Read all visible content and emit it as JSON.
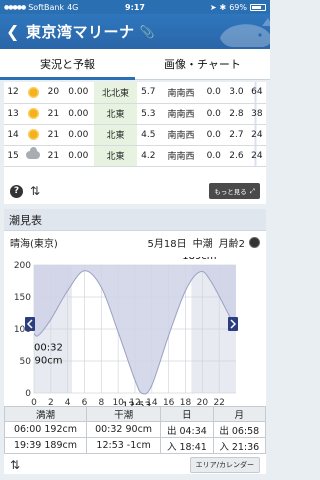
{
  "status": {
    "carrier": "SoftBank",
    "network": "4G",
    "time": "9:17",
    "battery": "69%"
  },
  "header": {
    "title": "東京湾マリーナ"
  },
  "tabs": [
    {
      "label": "実況と予報"
    },
    {
      "label": "画像・チャート"
    }
  ],
  "forecast": {
    "rows": [
      {
        "hour": "12",
        "weather": "sun",
        "temp": "20",
        "precip": "0.00",
        "wind_dir": "北北東",
        "wind_speed": "5.7",
        "wave_dir": "南南西",
        "wave_h": "0.0",
        "wave_p": "3.0",
        "last": "64"
      },
      {
        "hour": "13",
        "weather": "sun",
        "temp": "21",
        "precip": "0.00",
        "wind_dir": "北東",
        "wind_speed": "5.3",
        "wave_dir": "南南西",
        "wave_h": "0.0",
        "wave_p": "2.8",
        "last": "38"
      },
      {
        "hour": "14",
        "weather": "sun",
        "temp": "21",
        "precip": "0.00",
        "wind_dir": "北東",
        "wind_speed": "4.5",
        "wave_dir": "南南西",
        "wave_h": "0.0",
        "wave_p": "2.7",
        "last": "24"
      },
      {
        "hour": "15",
        "weather": "cloud",
        "temp": "21",
        "precip": "0.00",
        "wind_dir": "北東",
        "wind_speed": "4.2",
        "wave_dir": "南南西",
        "wave_h": "0.0",
        "wave_p": "2.6",
        "last": "24"
      }
    ],
    "more_label": "もっと見る"
  },
  "tide": {
    "section_title": "潮見表",
    "place": "晴海(東京)",
    "date": "5月18日",
    "phase": "中潮",
    "moon_age": "月齢2",
    "chart_data": {
      "type": "area",
      "x_ticks": [
        "0",
        "2",
        "4",
        "6",
        "8",
        "10",
        "12",
        "14",
        "16",
        "18",
        "20",
        "22"
      ],
      "y_ticks": [
        "200",
        "150",
        "100",
        "50",
        "0"
      ],
      "ylim": [
        -1,
        210
      ],
      "xlim": [
        0,
        24
      ],
      "x": [
        0,
        0.53,
        2,
        4,
        6,
        8,
        10,
        12,
        12.88,
        14,
        16,
        18,
        19.65,
        21,
        24
      ],
      "y": [
        93,
        90,
        115,
        160,
        191,
        165,
        95,
        20,
        -1,
        12,
        90,
        160,
        189,
        175,
        100
      ],
      "annotations": [
        {
          "time": "06:00",
          "level": "192cm",
          "x": 6.0,
          "y": 192
        },
        {
          "time": "19:39",
          "level": "189cm",
          "x": 19.65,
          "y": 189
        },
        {
          "time": "00:32",
          "level": "90cm",
          "x": 0.53,
          "y": 90
        },
        {
          "time": "12:53",
          "level": "-1cm",
          "x": 12.88,
          "y": -1
        }
      ]
    },
    "table": {
      "headers": [
        "満潮",
        "干潮",
        "日",
        "月"
      ],
      "rows": [
        [
          "06:00  192cm",
          "00:32  90cm",
          "出 04:34",
          "出 06:58"
        ],
        [
          "19:39  189cm",
          "12:53  -1cm",
          "入 18:41",
          "入 21:36"
        ]
      ]
    },
    "area_button": "エリア/カレンダー"
  }
}
